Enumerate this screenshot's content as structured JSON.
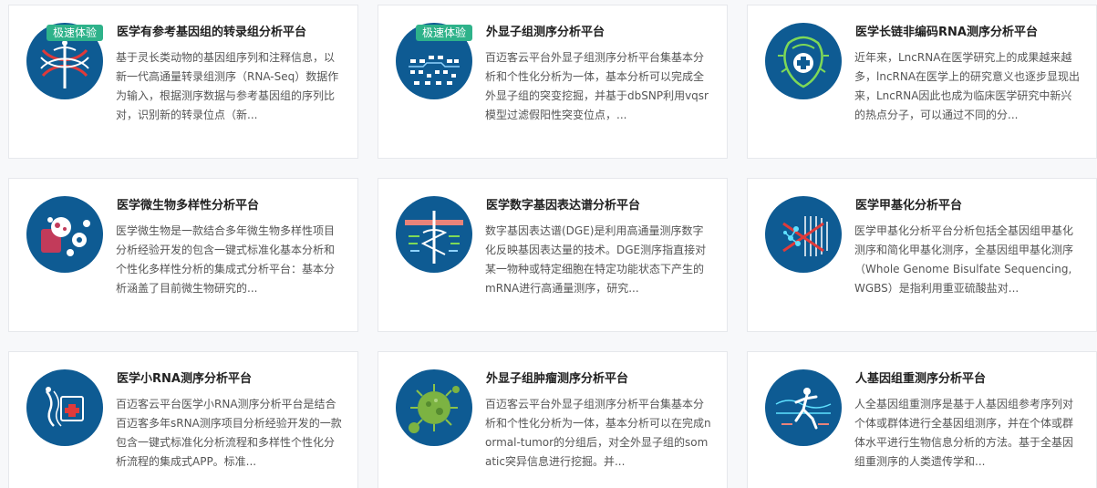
{
  "cards": [
    {
      "title": "医学有参考基因组的转录组分析平台",
      "badge": "极速体验",
      "icon": "dna-caduceus-icon",
      "desc": "基于灵长类动物的基因组序列和注释信息，以新一代高通量转录组测序（RNA-Seq）数据作为输入，根据测序数据与参考基因组的序列比对，识别新的转录位点（新..."
    },
    {
      "title": "外显子组测序分析平台",
      "badge": "极速体验",
      "icon": "exome-sequence-icon",
      "desc": "百迈客云平台外显子组测序分析平台集基本分析和个性化分析为一体，基本分析可以完成全外显子组的突变挖掘，并基于dbSNP利用vqsr模型过滤假阳性突变位点，..."
    },
    {
      "title": "医学长链非编码RNA测序分析平台",
      "badge": "",
      "icon": "lncrna-medical-icon",
      "desc": "近年来，LncRNA在医学研究上的成果越来越多，lncRNA在医学上的研究意义也逐步显现出来，LncRNA因此也成为临床医学研究中新兴的热点分子，可以通过不同的分..."
    },
    {
      "title": "医学微生物多样性分析平台",
      "badge": "",
      "icon": "microbe-icon",
      "desc": "医学微生物是一款结合多年微生物多样性项目分析经验开发的包含一键式标准化基本分析和个性化多样性分析的集成式分析平台：基本分析涵盖了目前微生物研究的..."
    },
    {
      "title": "医学数字基因表达谱分析平台",
      "badge": "",
      "icon": "gene-expression-icon",
      "desc": "数字基因表达谱(DGE)是利用高通量测序数字化反映基因表达量的技术。DGE测序指直接对某一物种或特定细胞在特定功能状态下产生的mRNA进行高通量测序，研究..."
    },
    {
      "title": "医学甲基化分析平台",
      "badge": "",
      "icon": "methylation-icon",
      "desc": "医学甲基化分析平台分析包括全基因组甲基化测序和简化甲基化测序，全基因组甲基化测序（Whole Genome Bisulfate Sequencing,WGBS）是指利用重亚硫酸盐对..."
    },
    {
      "title": "医学小RNA测序分析平台",
      "badge": "",
      "icon": "small-rna-icon",
      "desc": "百迈客云平台医学小RNA测序分析平台是结合百迈客多年sRNA测序项目分析经验开发的一款包含一键式标准化分析流程和多样性个性化分析流程的集成式APP。标准..."
    },
    {
      "title": "外显子组肿瘤测序分析平台",
      "badge": "",
      "icon": "tumor-virus-icon",
      "desc": "百迈客云平台外显子组测序分析平台集基本分析和个性化分析为一体，基本分析可以在完成normal-tumor的分组后，对全外显子组的somatic突异信息进行挖掘。并..."
    },
    {
      "title": "人基因组重测序分析平台",
      "badge": "",
      "icon": "human-resequencing-icon",
      "desc": "人全基因组重测序是基于人基因组参考序列对个体或群体进行全基因组测序，并在个体或群体水平进行生物信息分析的方法。基于全基因组重测序的人类遗传学和..."
    }
  ],
  "colors": {
    "icon_bg": "#0e5b93",
    "badge_bg": "#2eb28a",
    "accent_green": "#7ed957"
  }
}
